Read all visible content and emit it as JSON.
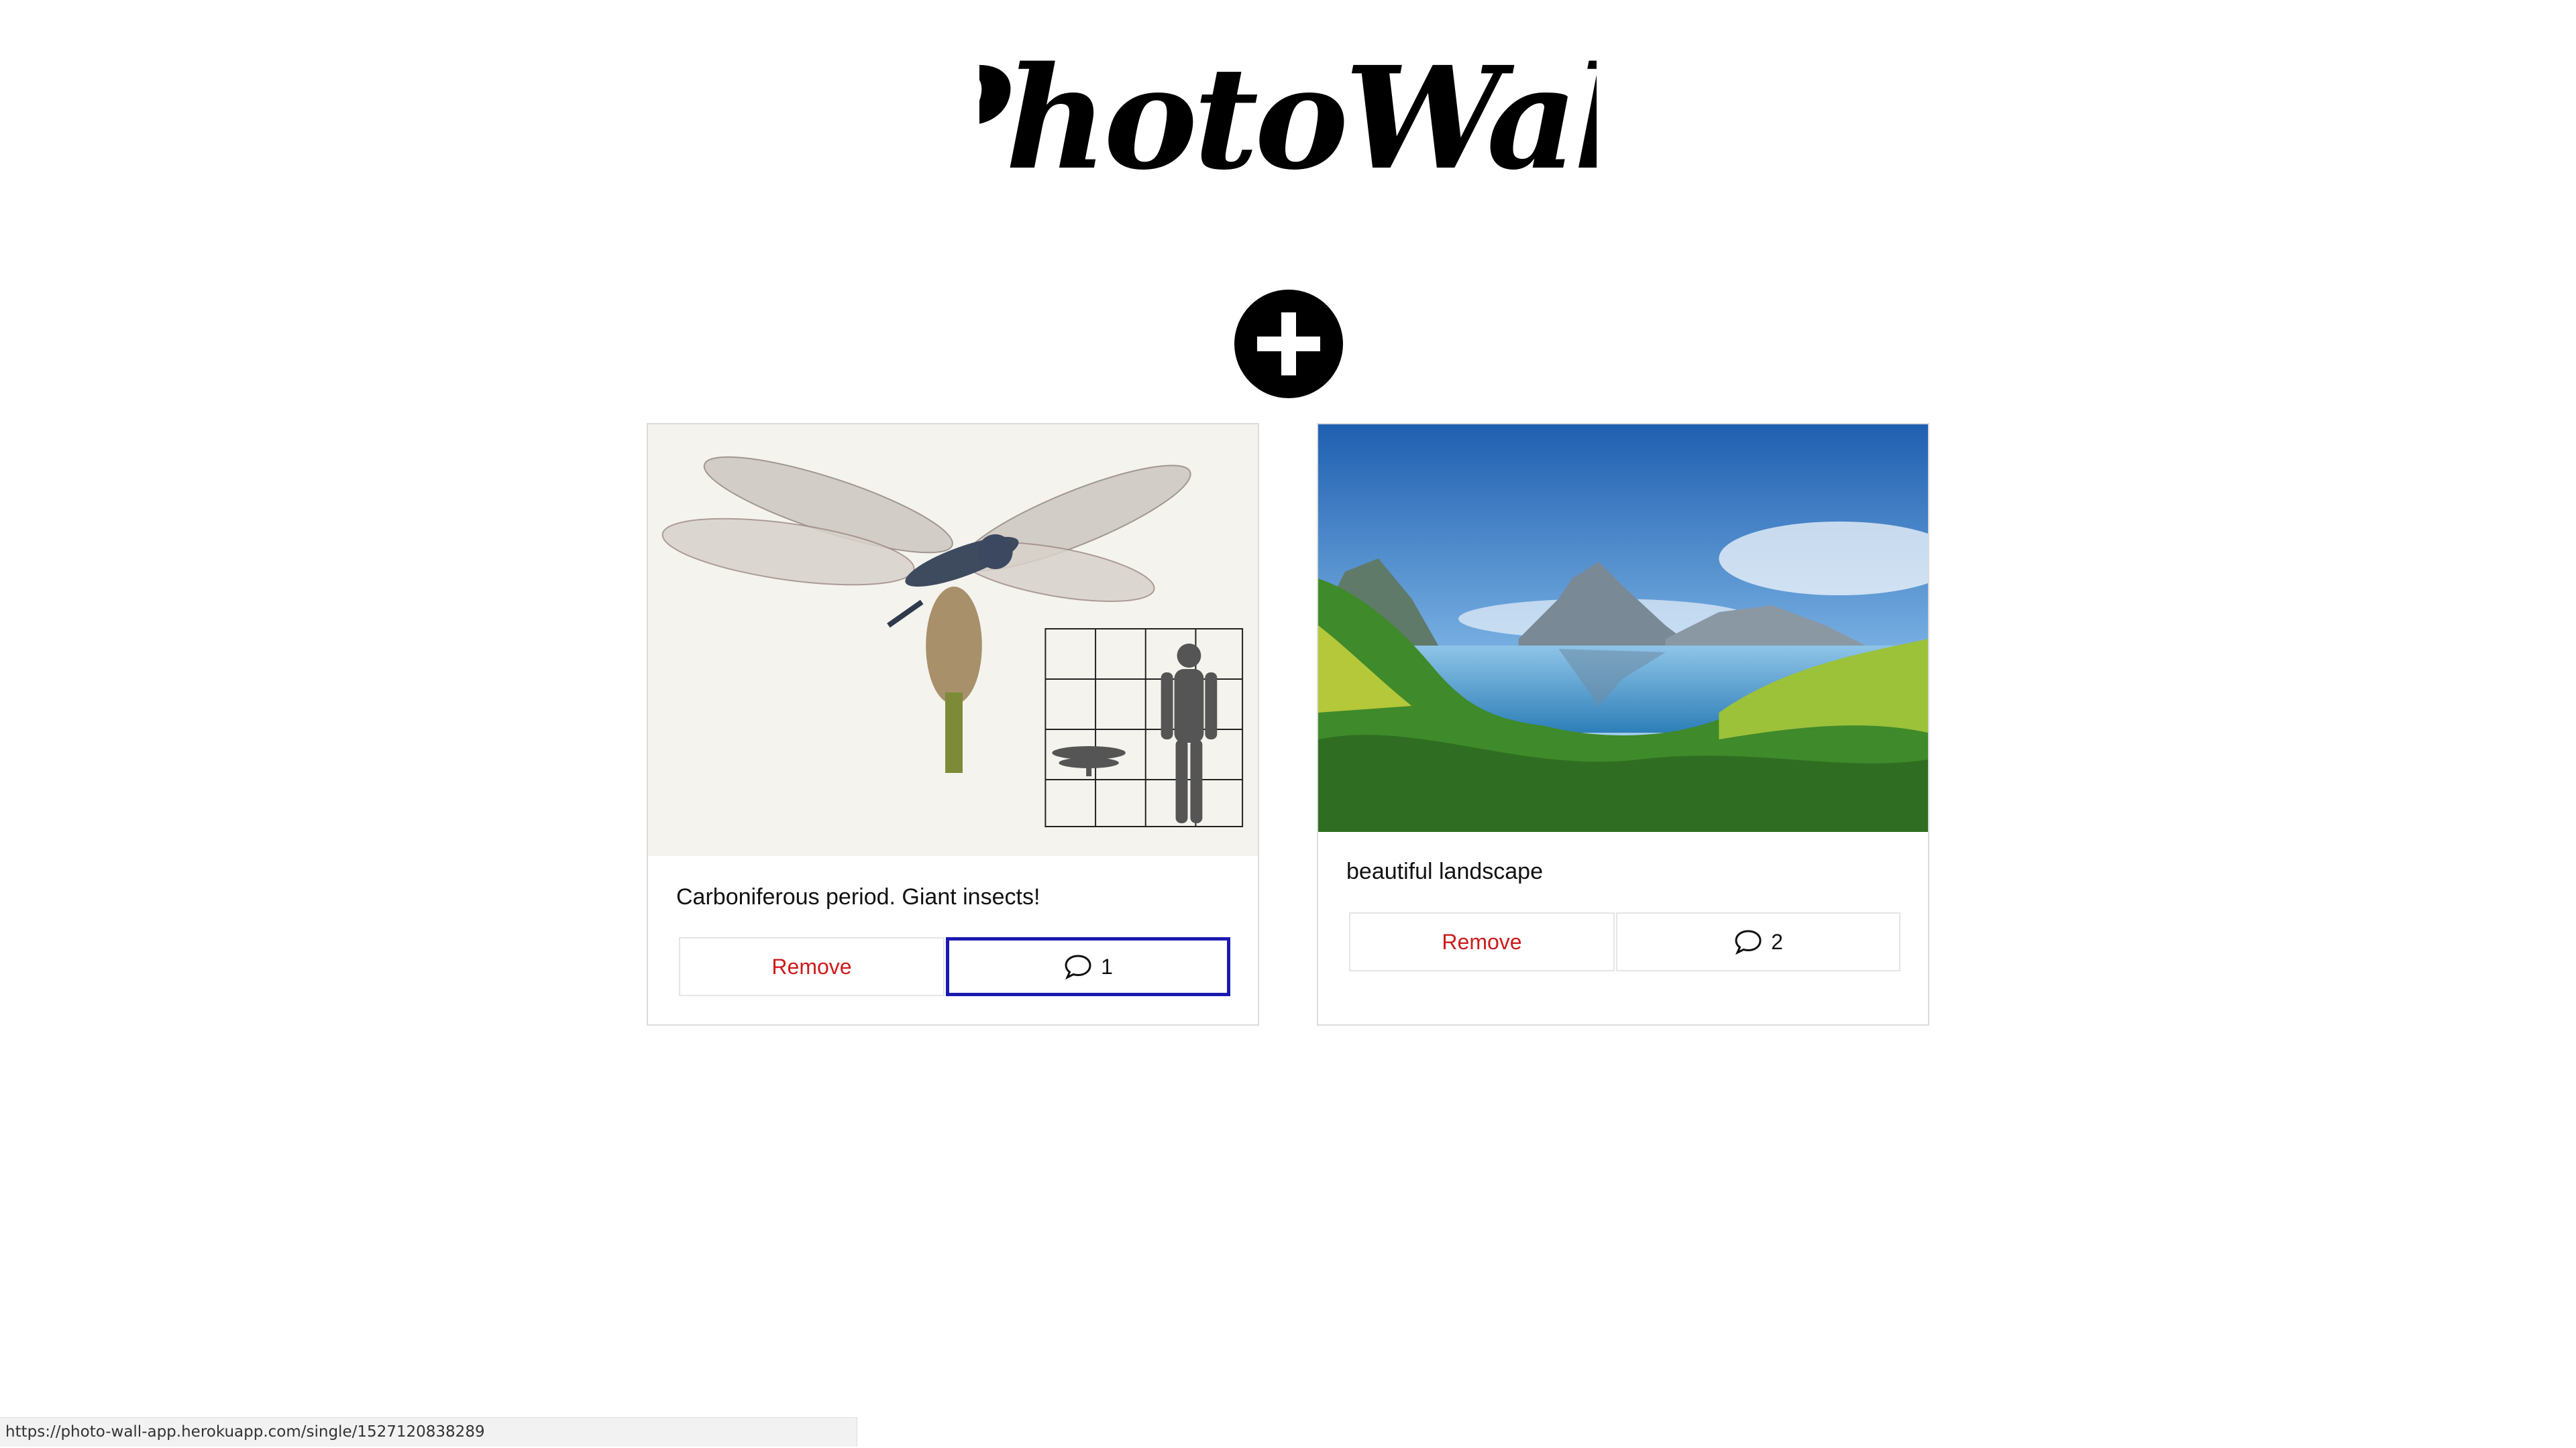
{
  "header": {
    "logo_text": "PhotoWall"
  },
  "toolbar": {
    "add_icon": "plus-circle-icon"
  },
  "posts": [
    {
      "description": "Carboniferous period. Giant insects!",
      "remove_label": "Remove",
      "comment_count": "1",
      "comment_icon": "speech-bubble-icon"
    },
    {
      "description": "beautiful landscape",
      "remove_label": "Remove",
      "comment_count": "2",
      "comment_icon": "speech-bubble-icon"
    }
  ],
  "status_bar": {
    "url": "https://photo-wall-app.herokuapp.com/single/1527120838289"
  },
  "colors": {
    "remove_text": "#cc1b1b",
    "focus_border": "#1a1ab0",
    "card_border": "#dcdcdc"
  }
}
